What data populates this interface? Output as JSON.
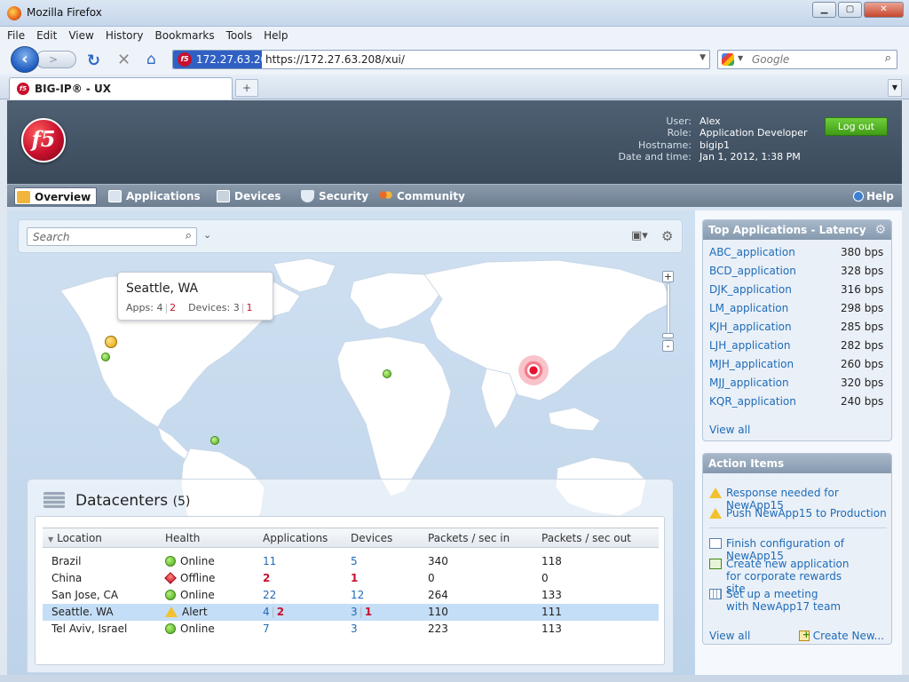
{
  "window": {
    "title": "Mozilla Firefox",
    "minimize": "▁",
    "maximize": "▢",
    "close": "✕"
  },
  "menu": [
    "File",
    "Edit",
    "View",
    "History",
    "Bookmarks",
    "Tools",
    "Help"
  ],
  "browser": {
    "site_identity": "172.27.63.208",
    "url": "https://172.27.63.208/xui/",
    "search_placeholder": "Google",
    "tab_title": "BIG-IP® - UX",
    "new_tab": "+"
  },
  "app": {
    "logo_text": "f5",
    "user": {
      "labels": [
        "User:",
        "Role:",
        "Hostname:",
        "Date and time:"
      ],
      "values": [
        "Alex",
        "Application Developer",
        "bigip1",
        "Jan 1, 2012, 1:38 PM"
      ]
    },
    "logout_label": "Log out",
    "nav": [
      "Overview",
      "Applications",
      "Devices",
      "Security",
      "Community"
    ],
    "help_label": "Help"
  },
  "map": {
    "search_placeholder": "Search",
    "popup": {
      "city": "Seattle, WA",
      "apps_label": "Apps:",
      "apps_ok": "4",
      "apps_bad": "2",
      "devices_label": "Devices:",
      "devices_ok": "3",
      "devices_bad": "1"
    },
    "zoom_in": "+",
    "zoom_out": "-"
  },
  "datacenters": {
    "title": "Datacenters",
    "count": "(5)",
    "columns": [
      "Location",
      "Health",
      "Applications",
      "Devices",
      "Packets / sec in",
      "Packets / sec out"
    ],
    "rows": [
      {
        "location": "Brazil",
        "health": "Online",
        "status": "ok",
        "apps": "11",
        "apps_bad": "",
        "devices": "5",
        "devices_bad": "",
        "in": "340",
        "out": "118"
      },
      {
        "location": "China",
        "health": "Offline",
        "status": "off",
        "apps": "",
        "apps_bad": "2",
        "devices": "",
        "devices_bad": "1",
        "in": "0",
        "out": "0"
      },
      {
        "location": "San Jose, CA",
        "health": "Online",
        "status": "ok",
        "apps": "22",
        "apps_bad": "",
        "devices": "12",
        "devices_bad": "",
        "in": "264",
        "out": "133"
      },
      {
        "location": "Seattle. WA",
        "health": "Alert",
        "status": "alert",
        "apps": "4",
        "apps_bad": "2",
        "devices": "3",
        "devices_bad": "1",
        "in": "110",
        "out": "111"
      },
      {
        "location": "Tel Aviv, Israel",
        "health": "Online",
        "status": "ok",
        "apps": "7",
        "apps_bad": "",
        "devices": "3",
        "devices_bad": "",
        "in": "223",
        "out": "113"
      }
    ]
  },
  "top_apps": {
    "title": "Top Applications - Latency",
    "items": [
      {
        "name": "ABC_application",
        "value": "380 bps"
      },
      {
        "name": "BCD_application",
        "value": "328 bps"
      },
      {
        "name": "DJK_application",
        "value": "316 bps"
      },
      {
        "name": "LM_application",
        "value": "298 bps"
      },
      {
        "name": "KJH_application",
        "value": "285 bps"
      },
      {
        "name": "LJH_application",
        "value": "282 bps"
      },
      {
        "name": "MJH_application",
        "value": "260 bps"
      },
      {
        "name": "MJJ_application",
        "value": "320 bps"
      },
      {
        "name": "KQR_application",
        "value": "240 bps"
      }
    ],
    "view_all": "View all"
  },
  "action_items": {
    "title": "Action Items",
    "items": [
      {
        "icon": "warning-icon",
        "text": "Response needed for NewApp15"
      },
      {
        "icon": "warning-icon",
        "text": "Push NewApp15 to Production"
      },
      {
        "icon": "form-icon",
        "text": "Finish configuration of NewApp15"
      },
      {
        "icon": "edit-icon",
        "text": "Create new application for corporate rewards site"
      },
      {
        "icon": "calendar-icon",
        "text": "Set up a meeting with NewApp17 team"
      }
    ],
    "view_all": "View all",
    "create_new": "Create New..."
  }
}
